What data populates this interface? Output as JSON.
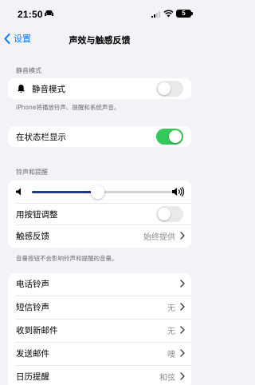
{
  "status_bar": {
    "time": "21:50",
    "battery": "5"
  },
  "nav": {
    "back_label": "设置",
    "title": "声效与触感反馈"
  },
  "silent_section": {
    "header": "静音模式",
    "row_label": "静音模式",
    "toggle_on": false,
    "footer": "iPhone将播放铃声、提醒和系统声音。"
  },
  "status_bar_section": {
    "row_label": "在状态栏显示",
    "toggle_on": true
  },
  "ringer_section": {
    "header": "铃声和提醒",
    "volume_level": 0.46,
    "adjust_label": "用按钮调整",
    "adjust_toggle_on": false,
    "haptics_label": "触感反馈",
    "haptics_value": "始终提供",
    "footer": "音量按钮不会影响铃声和提醒的音量。"
  },
  "sounds": [
    {
      "label": "电话铃声",
      "value": ""
    },
    {
      "label": "短信铃声",
      "value": "无"
    },
    {
      "label": "收到新邮件",
      "value": "无"
    },
    {
      "label": "发送邮件",
      "value": "嗖"
    },
    {
      "label": "日历提醒",
      "value": "和弦"
    }
  ],
  "colors": {
    "accent": "#007aff",
    "toggle_on": "#34c759",
    "slider_fill": "#1c3b8c"
  }
}
